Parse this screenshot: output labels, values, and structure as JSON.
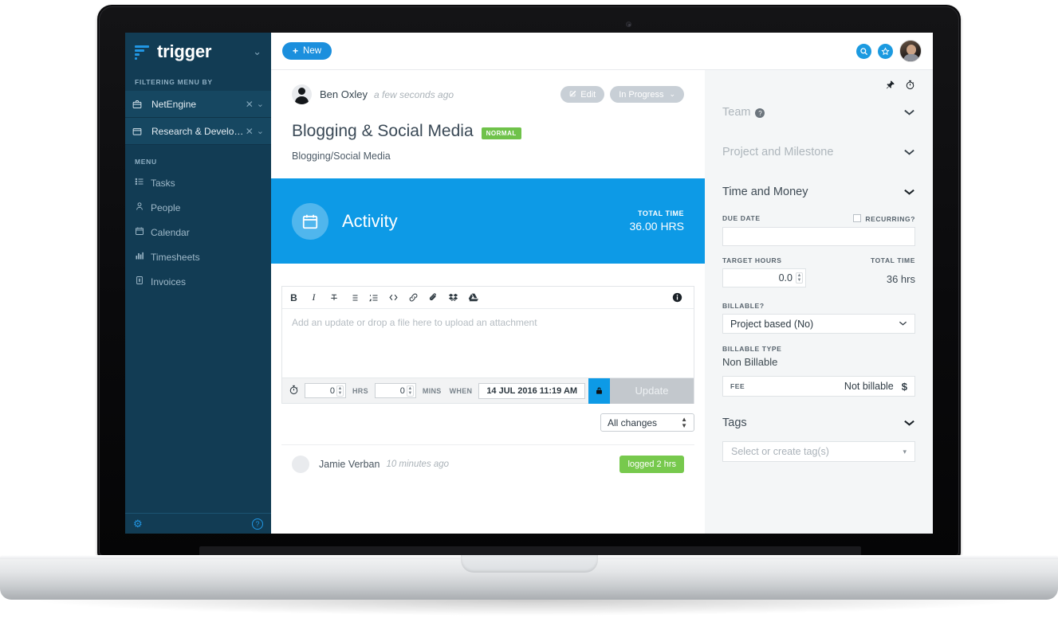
{
  "sidebar": {
    "brand": "trigger",
    "brand_caret": "⌄",
    "filter_label": "FILTERING MENU BY",
    "filters": [
      {
        "label": "NetEngine",
        "icon": "briefcase-icon",
        "close": "✕",
        "caret": "⌄"
      },
      {
        "label": "Research & Develo…",
        "icon": "folder-icon",
        "close": "✕",
        "caret": "⌄"
      }
    ],
    "menu_label": "MENU",
    "items": [
      {
        "label": "Tasks",
        "icon": "list-icon"
      },
      {
        "label": "People",
        "icon": "person-icon"
      },
      {
        "label": "Calendar",
        "icon": "calendar-icon"
      },
      {
        "label": "Timesheets",
        "icon": "chart-icon"
      },
      {
        "label": "Invoices",
        "icon": "invoice-icon"
      }
    ],
    "footer": {
      "settings_icon": "⚙",
      "help_icon": "?"
    }
  },
  "topbar": {
    "new_label": "New",
    "new_plus": "+",
    "search_icon": "⌕",
    "star_icon": "☆",
    "avatar": "user-avatar"
  },
  "task": {
    "author": "Ben Oxley",
    "timestamp": "a few seconds ago",
    "edit_label": "Edit",
    "status_label": "In Progress",
    "status_caret": "⌄",
    "title": "Blogging & Social Media",
    "priority_badge": "NORMAL",
    "subtitle": "Blogging/Social Media"
  },
  "activity": {
    "icon": "calendar-icon",
    "title": "Activity",
    "total_time_label": "TOTAL TIME",
    "total_time_value": "36.00 HRS"
  },
  "editor": {
    "toolbar": [
      {
        "name": "bold-icon",
        "glyph": "B"
      },
      {
        "name": "italic-icon",
        "glyph": "I"
      },
      {
        "name": "strikethrough-icon",
        "glyph": "T̶"
      },
      {
        "name": "bullet-list-icon",
        "glyph": "☰"
      },
      {
        "name": "numbered-list-icon",
        "glyph": "≡"
      },
      {
        "name": "code-icon",
        "glyph": "</>"
      },
      {
        "name": "link-icon",
        "glyph": "⛓"
      },
      {
        "name": "attachment-icon",
        "glyph": "📎"
      },
      {
        "name": "dropbox-icon",
        "glyph": "✦"
      },
      {
        "name": "google-drive-icon",
        "glyph": "△"
      }
    ],
    "info_icon": "i",
    "placeholder": "Add an update or drop a file here to upload an attachment",
    "stopwatch_icon": "⏱",
    "hours_value": "0",
    "hours_unit": "HRS",
    "mins_value": "0",
    "mins_unit": "MINS",
    "when_label": "WHEN",
    "when_value": "14 JUL 2016 11:19 AM",
    "lock_icon": "🔒",
    "update_label": "Update"
  },
  "changes": {
    "selected": "All changes"
  },
  "log": [
    {
      "name": "Jamie Verban",
      "time": "10 minutes ago",
      "badge": "logged 2 hrs"
    }
  ],
  "rpanel": {
    "pin_icon": "📌",
    "timer_icon": "⏱",
    "sections": [
      {
        "title": "Team",
        "has_help": true,
        "caret": "⌄",
        "style": "dim"
      },
      {
        "title": "Project and Milestone",
        "has_help": false,
        "caret": "⌄",
        "style": "dim"
      },
      {
        "title": "Time and Money",
        "has_help": false,
        "caret": "⌄",
        "style": "dark"
      }
    ],
    "due_date_label": "DUE DATE",
    "due_date_value": "",
    "recurring_label": "RECURRING?",
    "target_hours_label": "TARGET HOURS",
    "target_hours_value": "0.0",
    "total_time_label": "TOTAL TIME",
    "total_time_value": "36 hrs",
    "billable_label": "BILLABLE?",
    "billable_value": "Project based (No)",
    "billable_type_label": "BILLABLE TYPE",
    "billable_type_value": "Non Billable",
    "fee_label": "FEE",
    "fee_value": "Not billable",
    "fee_currency": "$",
    "tags_title": "Tags",
    "tags_caret": "⌄",
    "tags_placeholder": "Select or create tag(s)",
    "tags_caret_small": "▾"
  },
  "colors": {
    "accent_blue": "#0d9ae6",
    "brand_blue": "#1b8fdd",
    "sidebar_navy": "#123c54",
    "badge_green": "#6fc24a",
    "log_green": "#77c94d"
  }
}
